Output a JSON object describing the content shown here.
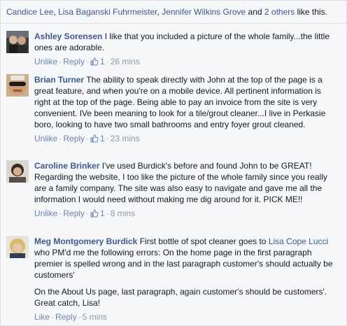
{
  "likes_bar": {
    "names": [
      {
        "text": "Candice Lee"
      },
      {
        "text": "Lisa Baganski Fuhrmeister"
      },
      {
        "text": "Jennifer Wilkins Grove"
      }
    ],
    "sep1": ", ",
    "sep2": ", ",
    "and": " and ",
    "others": "2 others",
    "suffix": " like this."
  },
  "comments": [
    {
      "author": "Ashley Sorensen",
      "text": "I like that you included a picture of the whole family...the little ones are adorable.",
      "action": "Unlike",
      "reply": "Reply",
      "like_count": "1",
      "time": "26 mins"
    },
    {
      "author": "Brian Turner",
      "text": "The ability to speak directly with John at the top of the page is a great feature, and when you're on a mobile device. All pertinent information is right at the top of the page. Being able to pay an invoice from the site is very convenient. IVe been meaning to look for a tile/grout cleaner...I live in Perkasie boro, looking to have two small bathrooms and entry foyer grout cleaned.",
      "action": "Unlike",
      "reply": "Reply",
      "like_count": "1",
      "time": "23 mins"
    },
    {
      "author": "Caroline Brinker",
      "text": "I've used Burdick's before and found John to be GREAT! Regarding the website, I too like the picture of the whole family since you really are a family company. The site was also easy to navigate and gave me all the information I would need without making me dig around for it. PICK ME!!",
      "action": "Unlike",
      "reply": "Reply",
      "like_count": "1",
      "time": "8 mins"
    },
    {
      "author": "Meg Montgomery Burdick",
      "text_before": "First bottle of spot cleaner goes to ",
      "mention": "Lisa Cope Lucci",
      "text_after": " who PM'd me the following errors: On the home page in the first paragraph premier is spelled wrong and in the last paragraph customer's should actually be customers'",
      "text2": "On the About Us page, last paragraph, again customer's should be customers'. Great catch, Lisa!",
      "action": "Like",
      "reply": "Reply",
      "time": "5 mins"
    }
  ],
  "colors": {
    "link": "#3b5998",
    "meta": "#9197a3",
    "background": "#f6f7f9"
  },
  "icons": {
    "like": "thumbs-up-icon"
  }
}
